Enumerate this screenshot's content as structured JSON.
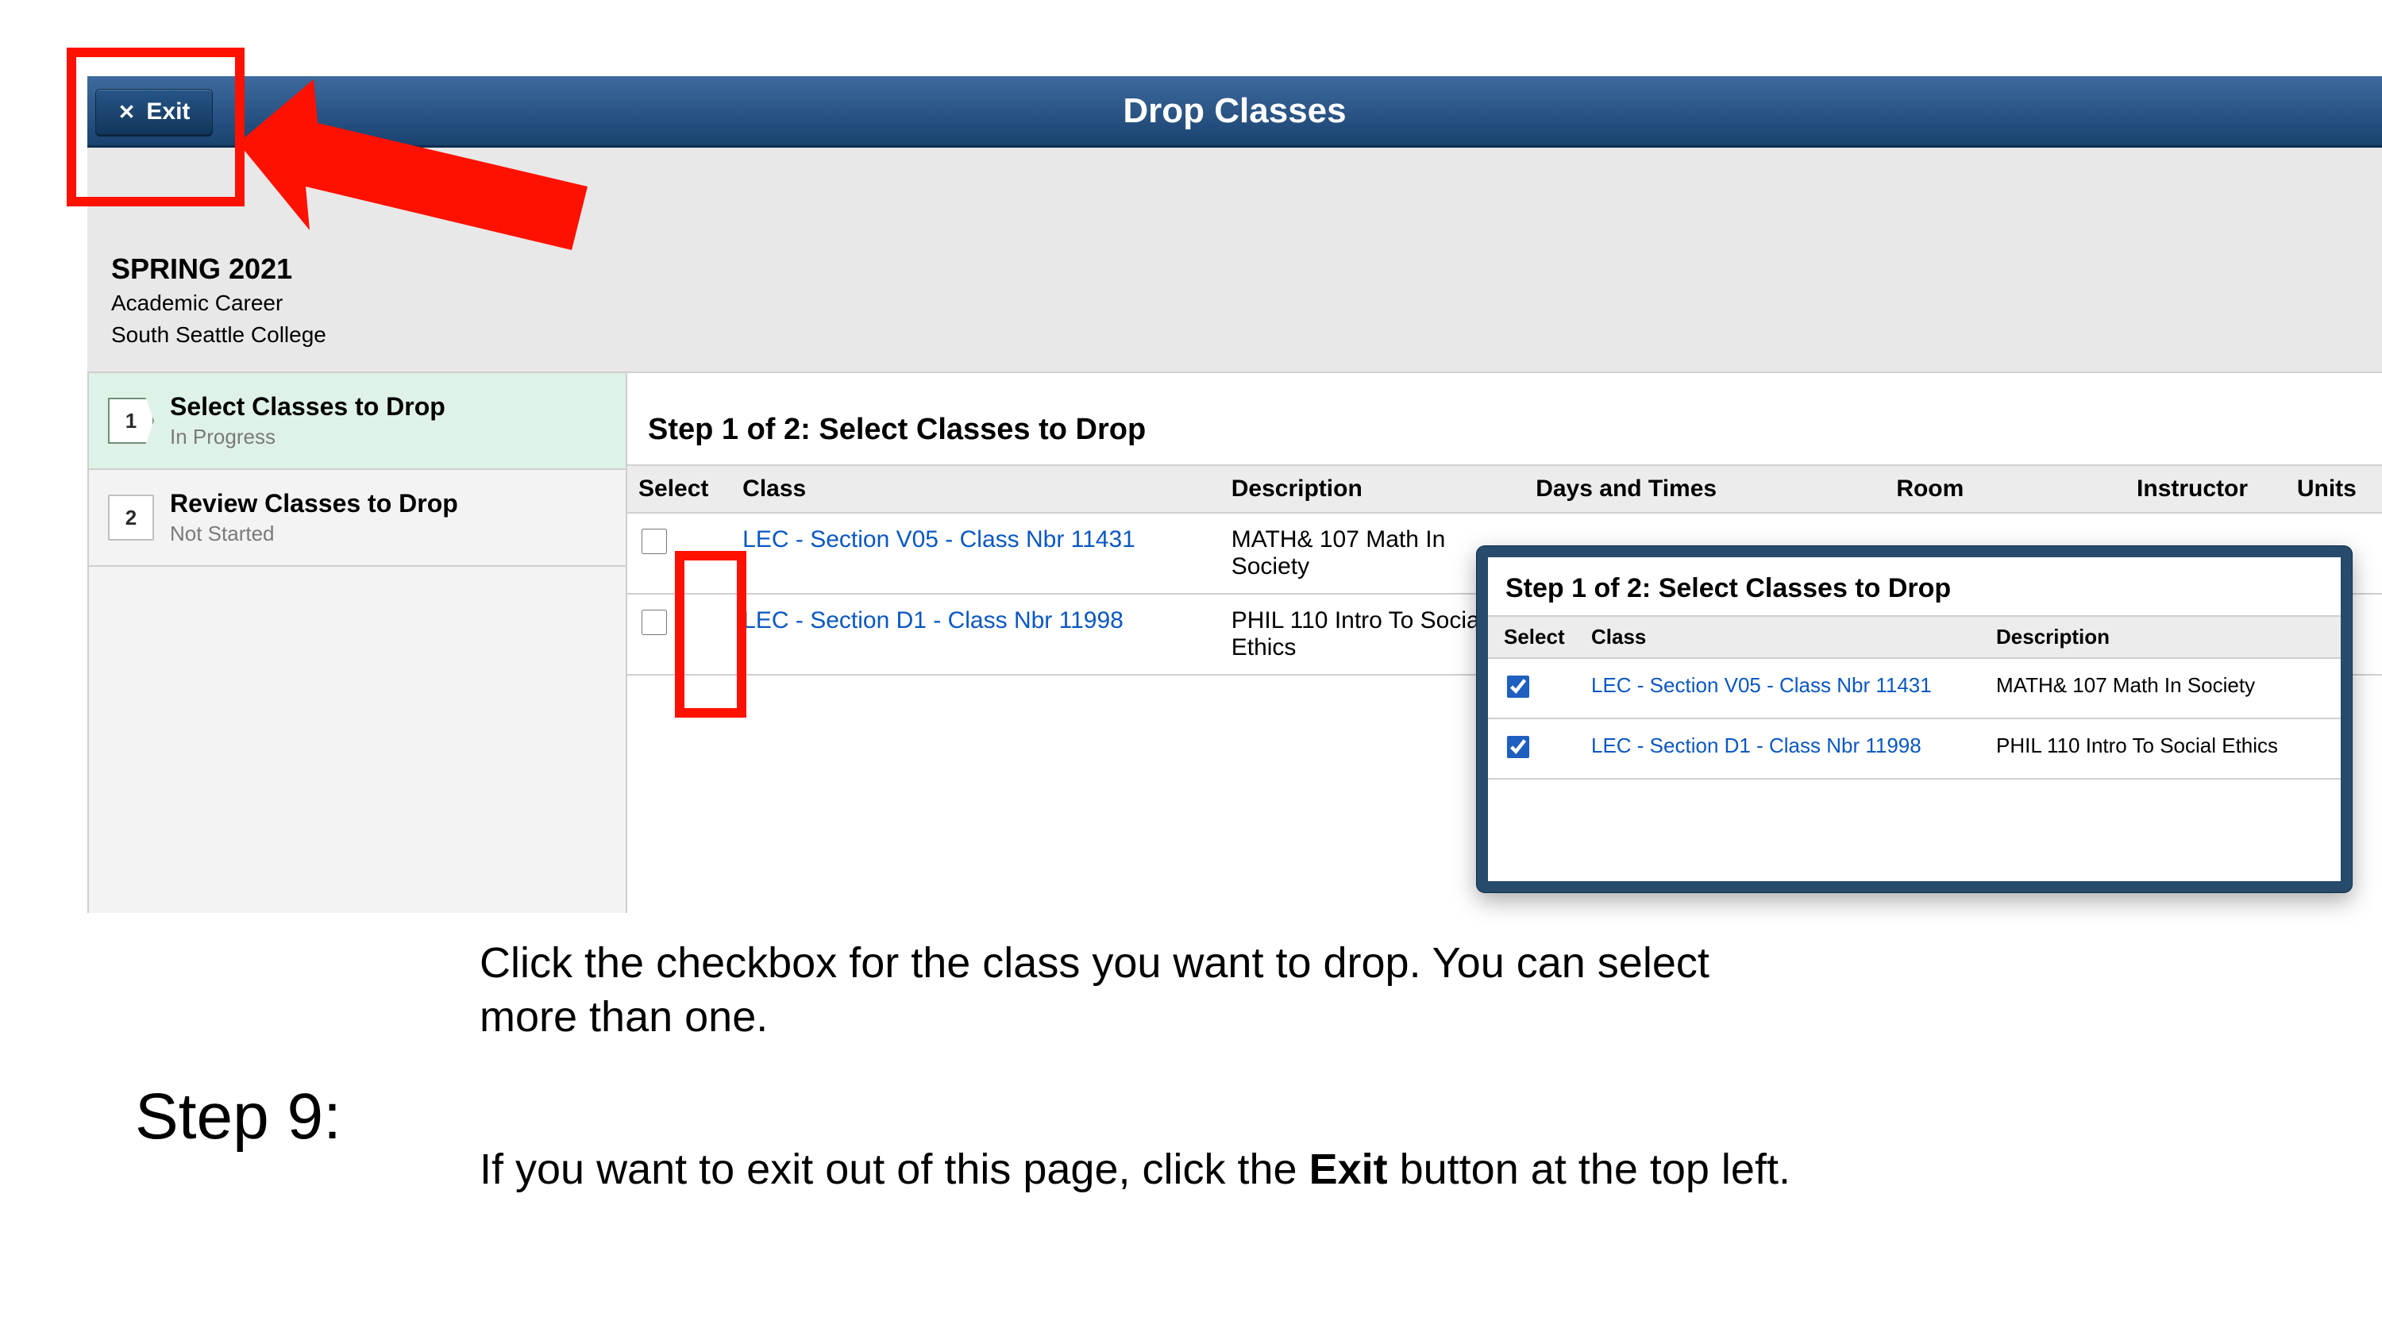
{
  "header": {
    "title": "Drop Classes",
    "exit_label": "Exit"
  },
  "termInfo": {
    "term": "SPRING 2021",
    "career": "Academic Career",
    "college": "South Seattle College"
  },
  "wizard": {
    "steps": [
      {
        "num": "1",
        "title": "Select Classes to Drop",
        "status": "In Progress",
        "active": true
      },
      {
        "num": "2",
        "title": "Review Classes to Drop",
        "status": "Not Started",
        "active": false
      }
    ]
  },
  "main": {
    "heading": "Step 1 of 2: Select Classes to Drop",
    "columns": {
      "select": "Select",
      "class": "Class",
      "description": "Description",
      "days": "Days and Times",
      "room": "Room",
      "instructor": "Instructor",
      "units": "Units"
    },
    "rows": [
      {
        "class": "LEC - Section V05 - Class Nbr 11431",
        "description": "MATH& 107  Math In Society"
      },
      {
        "class": "LEC - Section D1 - Class Nbr 11998",
        "description": "PHIL 110  Intro To Social Ethics"
      }
    ]
  },
  "popup": {
    "heading": "Step 1 of 2: Select Classes to Drop",
    "columns": {
      "select": "Select",
      "class": "Class",
      "description": "Description"
    },
    "rows": [
      {
        "class": "LEC - Section V05 - Class Nbr 11431",
        "description": "MATH& 107  Math In Society",
        "checked": true
      },
      {
        "class": "LEC - Section D1 - Class Nbr 11998",
        "description": "PHIL 110  Intro To Social Ethics",
        "checked": true
      }
    ]
  },
  "instructions": {
    "stepLabel": "Step 9:",
    "p1": "Click the checkbox for the class you want to drop. You can select more than one.",
    "p2_a": "If you want to exit out of this page, click the ",
    "p2_bold": "Exit",
    "p2_b": " button at the top left."
  }
}
